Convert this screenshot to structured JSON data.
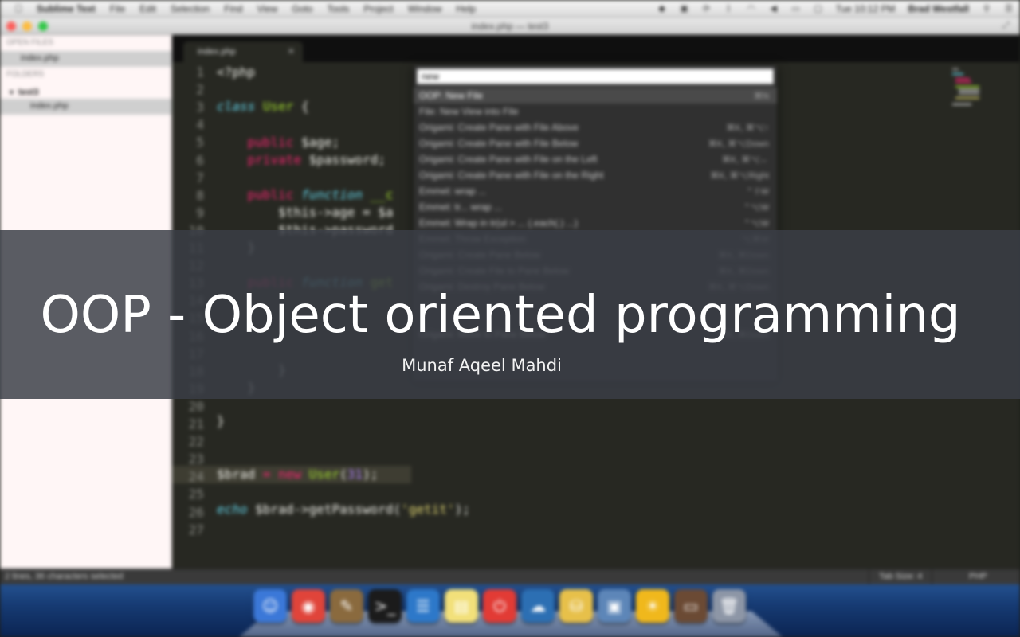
{
  "overlay": {
    "title": "OOP - Object oriented programming",
    "subtitle": "Munaf Aqeel Mahdi"
  },
  "menubar": {
    "app_name": "Sublime Text",
    "items": [
      "File",
      "Edit",
      "Selection",
      "Find",
      "View",
      "Goto",
      "Tools",
      "Project",
      "Window",
      "Help"
    ],
    "clock": "Tue 10:12 PM",
    "user": "Brad Westfall"
  },
  "window": {
    "title": "index.php — test3"
  },
  "sidebar": {
    "open_files_header": "OPEN FILES",
    "open_file": "index.php",
    "folders_header": "FOLDERS",
    "folder": "test3",
    "folder_file": "index.php"
  },
  "tab": {
    "label": "index.php"
  },
  "editor": {
    "line_numbers": [
      "1",
      "2",
      "3",
      "4",
      "5",
      "6",
      "7",
      "8",
      "9",
      "10",
      "11",
      "12",
      "13",
      "14",
      "15",
      "16",
      "17",
      "18",
      "19",
      "20",
      "21",
      "22",
      "23",
      "24",
      "25",
      "26",
      "27"
    ],
    "lines": {
      "l1": "<?php",
      "l3_kw": "class",
      "l3_name": "User",
      "l3_rest": " {",
      "l5_kw": "public",
      "l5_var": " $age;",
      "l6_kw": "private",
      "l6_var": " $password;",
      "l8_kw": "public",
      "l8_fn": " function",
      "l8_name": " __c",
      "l9": "$this->age = $a",
      "l10": "$this->password",
      "l11": "}",
      "l13_kw": "public",
      "l13_fn": " function",
      "l13_name": " get",
      "l19": "}",
      "l20": "}",
      "l21": "}",
      "l24_var": "$brad",
      "l24_op": " = ",
      "l24_new": "new",
      "l24_cls": " User",
      "l24_open": "(",
      "l24_num": "31",
      "l24_close": ");",
      "l26_echo": "echo",
      "l26_var": " $brad",
      "l26_method": "->getPassword(",
      "l26_str": "'getit'",
      "l26_close": ");"
    }
  },
  "palette": {
    "query": "new",
    "items": [
      {
        "label": "OOP: New File",
        "shortcut": "⌘N"
      },
      {
        "label": "File: New View into File",
        "shortcut": ""
      },
      {
        "label": "Origami: Create Pane with File Above",
        "shortcut": "⌘K, ⌘⌥↑"
      },
      {
        "label": "Origami: Create Pane with File Below",
        "shortcut": "⌘K, ⌘⌥Down"
      },
      {
        "label": "Origami: Create Pane with File on the Left",
        "shortcut": "⌘K, ⌘⌥←"
      },
      {
        "label": "Origami: Create Pane with File on the Right",
        "shortcut": "⌘K, ⌘⌥Right"
      },
      {
        "label": "Emmet: wrap ...",
        "shortcut": "⌃⇧W"
      },
      {
        "label": "Emmet: tr... wrap ...",
        "shortcut": "⌃⌥W"
      },
      {
        "label": "Emmet: Wrap in tr(ul > ... (.each(.) ...)",
        "shortcut": "⌃⌥W"
      },
      {
        "label": "Emmet: Throw Exception",
        "shortcut": "⌥⌘W"
      },
      {
        "label": "Origami: Create Pane Below",
        "shortcut": "⌘K, ⌘Down"
      },
      {
        "label": "Origami: Create File to Pane Below",
        "shortcut": "⌘K, ⌘Down"
      },
      {
        "label": "Origami: Destroy Pane Below",
        "shortcut": "⌘K, ⌘⌥Down"
      },
      {
        "label": "",
        "shortcut": ""
      },
      {
        "label": "",
        "shortcut": ""
      },
      {
        "label": "Origami: Move to Pane Below",
        "shortcut": "⌘K, ⌘Down"
      }
    ]
  },
  "status": {
    "left": "2 lines, 36 characters selected",
    "tab_size": "Tab Size: 4",
    "syntax": "PHP"
  },
  "dock": {
    "icons": [
      {
        "name": "finder-icon",
        "glyph": "☺",
        "color": "#3b78d8"
      },
      {
        "name": "chrome-icon",
        "glyph": "◉",
        "color": "#e0443a"
      },
      {
        "name": "notes-icon",
        "glyph": "✎",
        "color": "#8a6a3e"
      },
      {
        "name": "terminal-icon",
        "glyph": ">_",
        "color": "#1b1b1b"
      },
      {
        "name": "list-app-icon",
        "glyph": "☰",
        "color": "#2d78c9"
      },
      {
        "name": "stickies-icon",
        "glyph": "▤",
        "color": "#f2e07a"
      },
      {
        "name": "power-icon",
        "glyph": "⏻",
        "color": "#e23b35"
      },
      {
        "name": "cloud-app-icon",
        "glyph": "☁",
        "color": "#2c6fb3"
      },
      {
        "name": "database-icon",
        "glyph": "⛁",
        "color": "#e7c04a"
      },
      {
        "name": "virtualbox-icon",
        "glyph": "▣",
        "color": "#5d86b8"
      },
      {
        "name": "sun-app-icon",
        "glyph": "☀",
        "color": "#f0b81c"
      },
      {
        "name": "sequel-icon",
        "glyph": "▭",
        "color": "#6b4a34"
      },
      {
        "name": "trash-icon",
        "glyph": "🗑",
        "color": "#8d96a6"
      }
    ]
  }
}
